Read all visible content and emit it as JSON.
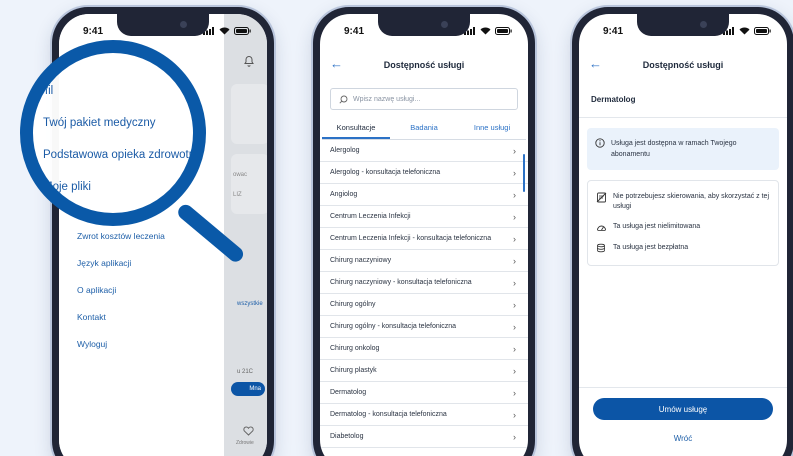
{
  "status": {
    "time": "9:41"
  },
  "phone1": {
    "menu": [
      "Zwrot kosztów leczenia",
      "Język aplikacji",
      "O aplikacji",
      "Kontakt",
      "Wyloguj"
    ],
    "magnified": [
      "Profil",
      "Twój pakiet medyczny",
      "Podstawowa opieka zdrowotna",
      "Moje pliki"
    ],
    "background_fragments": [
      "owac",
      "LIZ",
      "wszystkie",
      "u 21C",
      "Mna",
      "Zdrowie"
    ]
  },
  "phone2": {
    "title": "Dostępność usługi",
    "search_placeholder": "Wpisz nazwę usługi...",
    "tabs": [
      "Konsultacje",
      "Badania",
      "Inne usługi"
    ],
    "items": [
      "Alergolog",
      "Alergolog - konsultacja telefoniczna",
      "Angiolog",
      "Centrum Leczenia Infekcji",
      "Centrum Leczenia Infekcji - konsultacja telefoniczna",
      "Chirurg naczyniowy",
      "Chirurg naczyniowy - konsultacja telefoniczna",
      "Chirurg ogólny",
      "Chirurg ogólny - konsultacja telefoniczna",
      "Chirurg onkolog",
      "Chirurg plastyk",
      "Dermatolog",
      "Dermatolog - konsultacja telefoniczna",
      "Diabetolog"
    ]
  },
  "phone3": {
    "title": "Dostępność usługi",
    "service": "Dermatolog",
    "info": "Usługa jest dostępna w ramach Twojego abonamentu",
    "features": [
      "Nie potrzebujesz skierowania, aby skorzystać z tej usługi",
      "Ta usługa jest nielimitowana",
      "Ta usługa jest bezpłatna"
    ],
    "primary_button": "Umów usługę",
    "secondary_button": "Wróć"
  },
  "colors": {
    "brand": "#0a59a8",
    "link": "#1e5fa8",
    "info_bg": "#eaf2fb"
  }
}
